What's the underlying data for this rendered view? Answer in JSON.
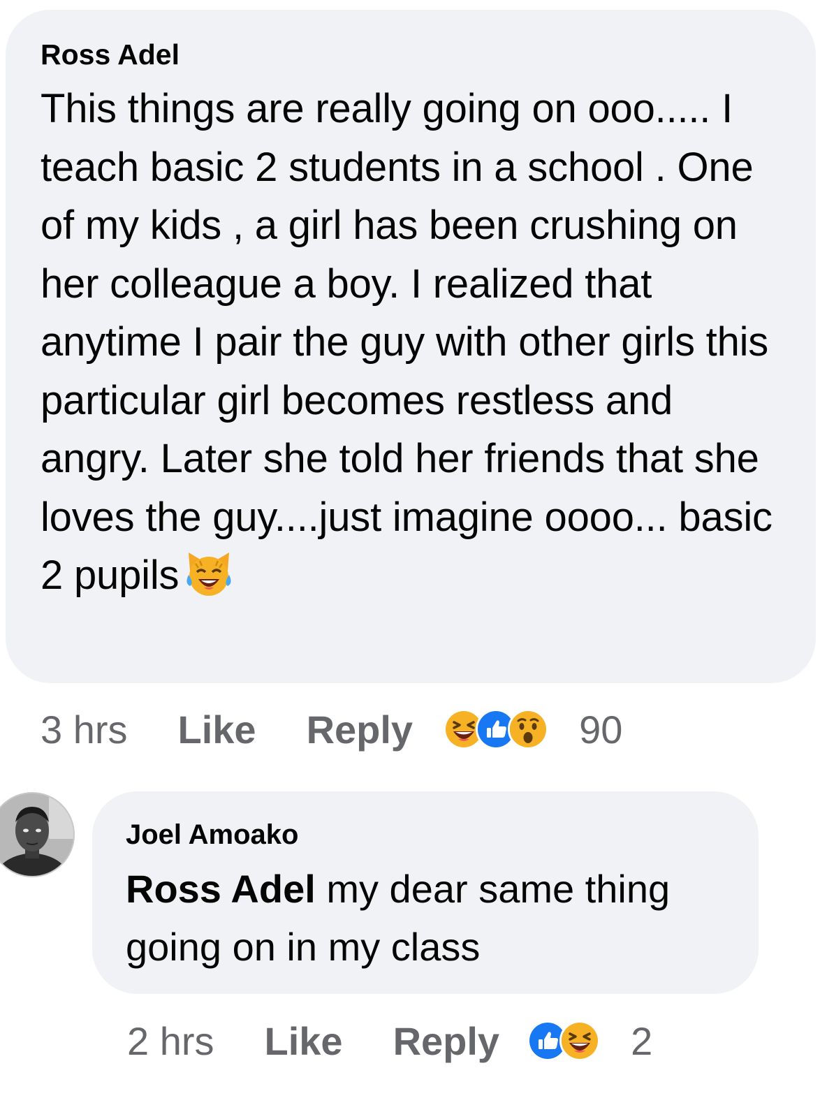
{
  "comments": [
    {
      "author": "Ross Adel",
      "text": "This things are really going on ooo..... I teach basic 2 students in a school . One of my kids , a girl has been crushing on her colleague a boy. I realized that anytime I pair the guy with other girls this particular girl becomes restless and angry. Later she told her friends that she loves the guy....just imagine oooo... basic 2 pupils",
      "emoji": "laughing-cat-tears",
      "time": "3 hrs",
      "like_label": "Like",
      "reply_label": "Reply",
      "reactions": [
        "haha",
        "like",
        "wow"
      ],
      "reaction_count": "90"
    },
    {
      "author": "Joel Amoako",
      "mention": "Ross Adel",
      "text": " my dear same thing going on in my class",
      "time": "2 hrs",
      "like_label": "Like",
      "reply_label": "Reply",
      "reactions": [
        "like",
        "haha"
      ],
      "reaction_count": "2"
    }
  ],
  "colors": {
    "bubble": "#f0f2f5",
    "meta_text": "#65676b",
    "like_blue": "#1877f2",
    "emoji_yellow": "#f7b125"
  }
}
